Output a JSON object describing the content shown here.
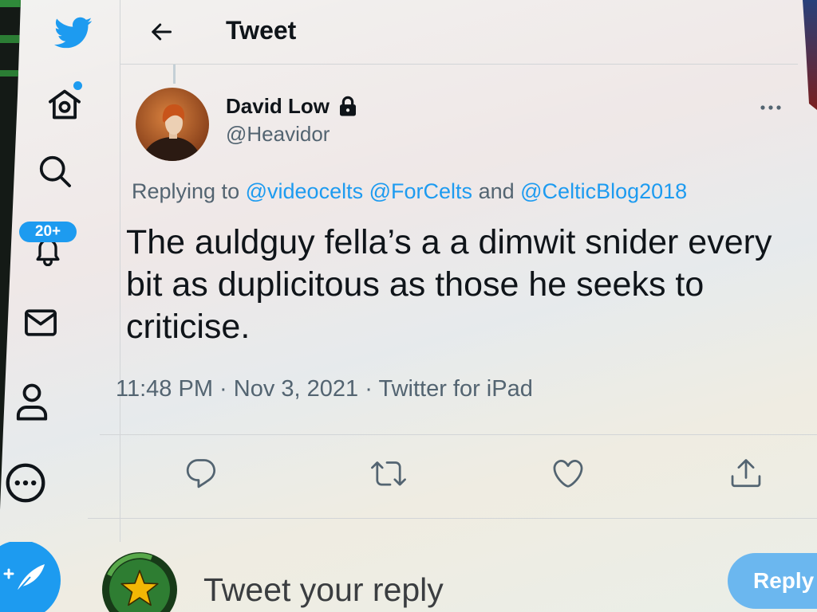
{
  "sidebar": {
    "items": [
      {
        "id": "logo",
        "icon": "twitter-bird-icon"
      },
      {
        "id": "home",
        "icon": "home-icon",
        "has_notification_dot": true
      },
      {
        "id": "explore",
        "icon": "search-icon"
      },
      {
        "id": "notifications",
        "icon": "bell-icon",
        "badge": "20+"
      },
      {
        "id": "messages",
        "icon": "mail-icon"
      },
      {
        "id": "profile",
        "icon": "profile-icon"
      },
      {
        "id": "more",
        "icon": "more-circle-icon"
      }
    ],
    "compose_icon": "compose-feather-icon"
  },
  "header": {
    "back_icon": "back-arrow-icon",
    "title": "Tweet"
  },
  "tweet": {
    "author": {
      "name": "David Low",
      "handle": "@Heavidor",
      "protected": true,
      "lock_icon": "lock-icon"
    },
    "more_icon": "more-dots-icon",
    "replying_to": {
      "label": "Replying to",
      "mentions": [
        "@videocelts",
        "@ForCelts",
        "@CelticBlog2018"
      ],
      "conjunction": "and"
    },
    "text": "The auldguy fella’s a a dimwit snider every bit as duplicitous as those he seeks to criticise.",
    "meta": {
      "time": "11:48 PM",
      "date": "Nov 3, 2021",
      "source": "Twitter for iPad",
      "separator": "·"
    },
    "actions": [
      {
        "id": "reply",
        "icon": "reply-icon"
      },
      {
        "id": "retweet",
        "icon": "retweet-icon"
      },
      {
        "id": "like",
        "icon": "heart-icon"
      },
      {
        "id": "share",
        "icon": "share-icon"
      }
    ]
  },
  "reply_box": {
    "avatar_icon": "star-avatar",
    "placeholder": "Tweet your reply",
    "button_label": "Reply"
  },
  "colors": {
    "accent": "#1d9bf0",
    "text_primary": "#0f1419",
    "text_secondary": "#536471",
    "reply_button": "#6bb7ef",
    "divider": "#d2d5d7",
    "avatar_green": "#2e7d32",
    "star_gold": "#f2b705"
  }
}
